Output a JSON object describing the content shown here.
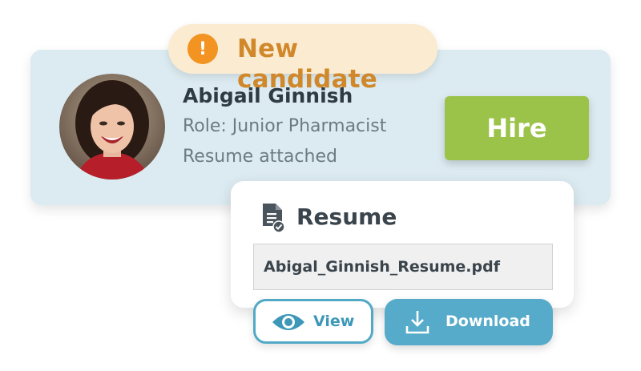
{
  "alert": {
    "label": "New candidate",
    "icon": "exclamation-icon",
    "icon_glyph": "!",
    "color": "#f39321"
  },
  "candidate": {
    "name": "Abigail Ginnish",
    "role": "Role: Junior Pharmacist",
    "resume_status": "Resume attached",
    "avatar": "candidate-photo"
  },
  "actions": {
    "hire_label": "Hire",
    "hire_color": "#9bc34a"
  },
  "resume": {
    "title": "Resume",
    "icon": "document-check-icon",
    "file_name": "Abigal_Ginnish_Resume.pdf",
    "view_label": "View",
    "view_icon": "eye-icon",
    "download_label": "Download",
    "download_icon": "download-icon",
    "accent_color": "#55abc9"
  }
}
